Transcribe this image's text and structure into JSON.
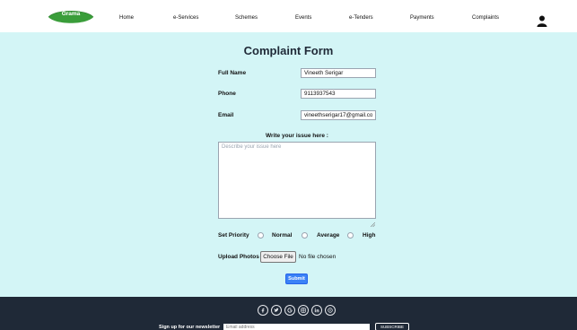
{
  "brand": {
    "logo_text": "Grama"
  },
  "nav": {
    "links": [
      "Home",
      "e-Services",
      "Schemes",
      "Events",
      "e-Tenders",
      "Payments",
      "Complaints"
    ]
  },
  "form": {
    "title": "Complaint Form",
    "fields": {
      "full_name": {
        "label": "Full Name",
        "value": "Vineeth Serigar"
      },
      "phone": {
        "label": "Phone",
        "value": "9113937543"
      },
      "email": {
        "label": "Email",
        "value": "vineethserigar17@gmail.com"
      }
    },
    "issue": {
      "label": "Write your issue here :",
      "placeholder": "Describe your issue here"
    },
    "priority": {
      "label": "Set Priority",
      "options": [
        "Normal",
        "Average",
        "High"
      ]
    },
    "upload": {
      "label": "Upload Photos",
      "button": "Choose File",
      "status": "No file chosen"
    },
    "submit_label": "Submit"
  },
  "footer": {
    "social_icons": [
      "facebook-icon",
      "twitter-icon",
      "google-icon",
      "instagram-icon",
      "linkedin-icon",
      "github-icon"
    ],
    "newsletter_label": "Sign up for our newsletter",
    "newsletter_placeholder": "Email address",
    "subscribe_label": "SUBSCRIBE"
  },
  "colors": {
    "page_bg": "#d3f5f6",
    "logo_green": "#3a9d3a",
    "submit_blue": "#3b82f6",
    "footer_bg": "#1f2937"
  }
}
